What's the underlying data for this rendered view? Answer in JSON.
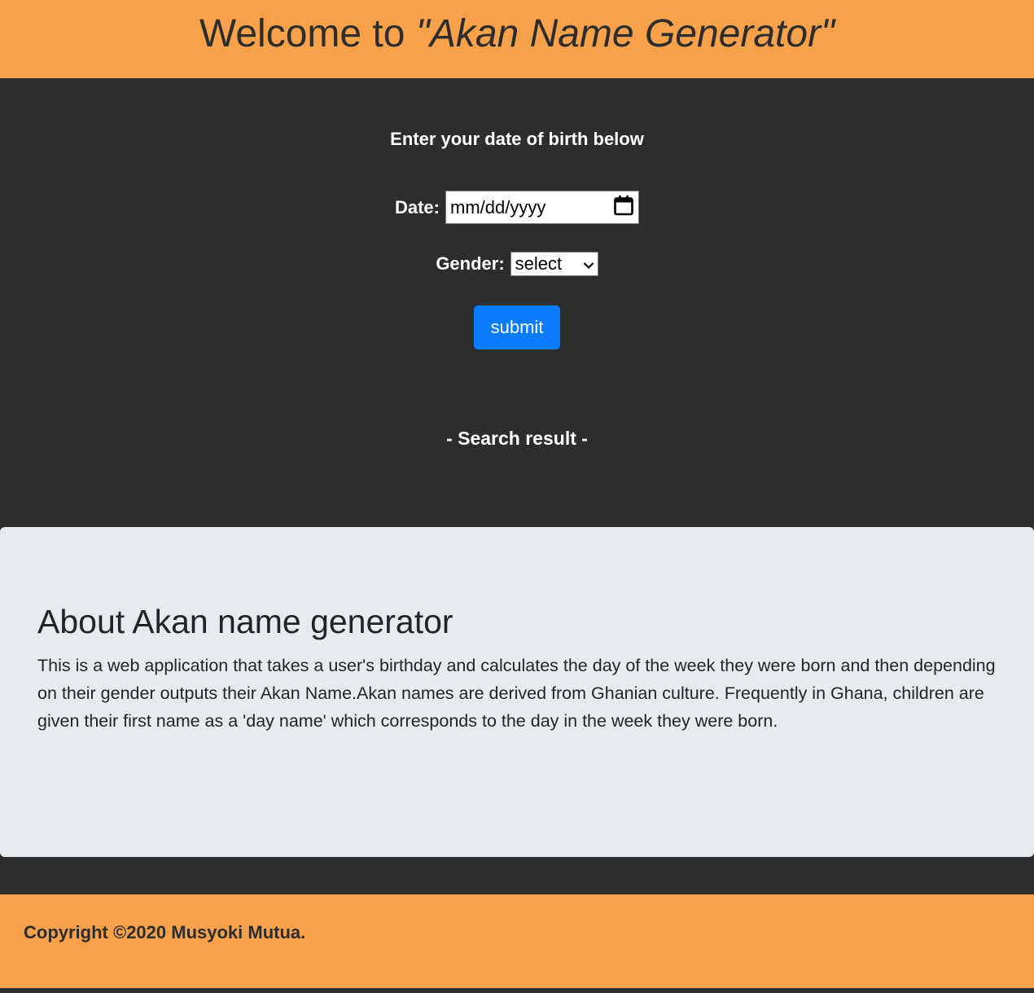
{
  "header": {
    "title_prefix": "Welcome to ",
    "title_name": "\"Akan Name Generator\""
  },
  "form": {
    "prompt": "Enter your date of birth below",
    "date_label": "Date:",
    "date_placeholder": "mm/dd/yyyy",
    "gender_label": "Gender:",
    "gender_selected": "select",
    "submit_label": "submit"
  },
  "result": {
    "heading": "- Search result -"
  },
  "about": {
    "title": "About Akan name generator",
    "body": "This is a web application that takes a user's birthday and calculates the day of the week they were born and then depending on their gender outputs their Akan Name.Akan names are derived from Ghanian culture. Frequently in Ghana, children are given their first name as a 'day name' which corresponds to the day in the week they were born."
  },
  "footer": {
    "copyright": "Copyright ©2020 Musyoki Mutua."
  },
  "colors": {
    "accent": "#f7a24b",
    "background": "#2d2d2d",
    "button": "#0a7cff",
    "about_bg": "#e7ebee"
  },
  "icons": {
    "date_picker": "calendar-icon",
    "select_arrow": "chevron-down-icon"
  }
}
